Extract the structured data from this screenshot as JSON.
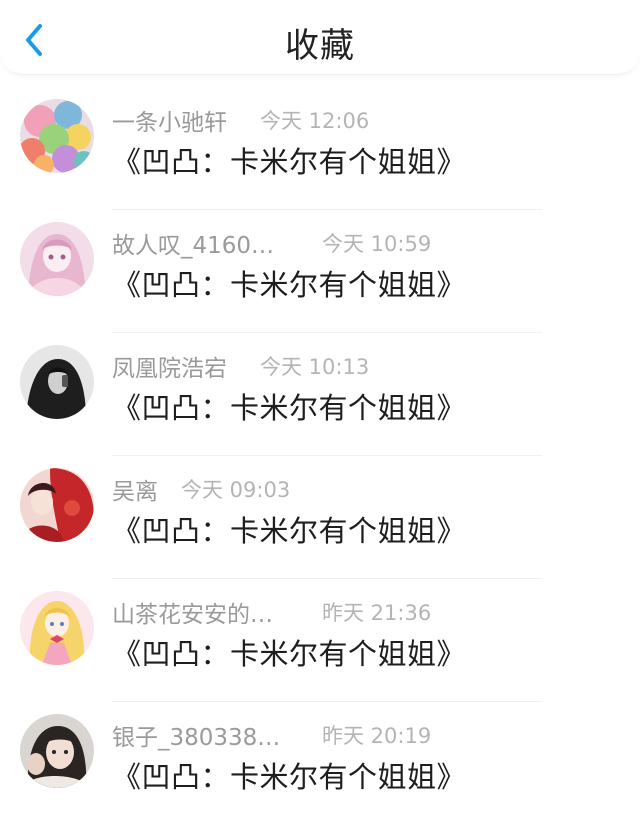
{
  "header": {
    "title": "收藏",
    "back_icon": "chevron-left-icon",
    "accent_color": "#1a9be8"
  },
  "items": [
    {
      "name": "一条小驰轩",
      "time": "今天 12:06",
      "message": "《凹凸：卡米尔有个姐姐》",
      "avatar": "balloons-avatar"
    },
    {
      "name": "故人叹_4160…",
      "time": "今天 10:59",
      "message": "《凹凸：卡米尔有个姐姐》",
      "avatar": "pink-anime-girl-avatar"
    },
    {
      "name": "凤凰院浩宕",
      "time": "今天 10:13",
      "message": "《凹凸：卡米尔有个姐姐》",
      "avatar": "dark-portrait-avatar"
    },
    {
      "name": "吴离",
      "time": "今天 09:03",
      "message": "《凹凸：卡米尔有个姐姐》",
      "avatar": "red-anime-avatar"
    },
    {
      "name": "山茶花安安的…",
      "time": "昨天 21:36",
      "message": "《凹凸：卡米尔有个姐姐》",
      "avatar": "blonde-anime-girl-avatar"
    },
    {
      "name": "银子_380338…",
      "time": "昨天 20:19",
      "message": "《凹凸：卡米尔有个姐姐》",
      "avatar": "photo-girl-avatar"
    }
  ]
}
